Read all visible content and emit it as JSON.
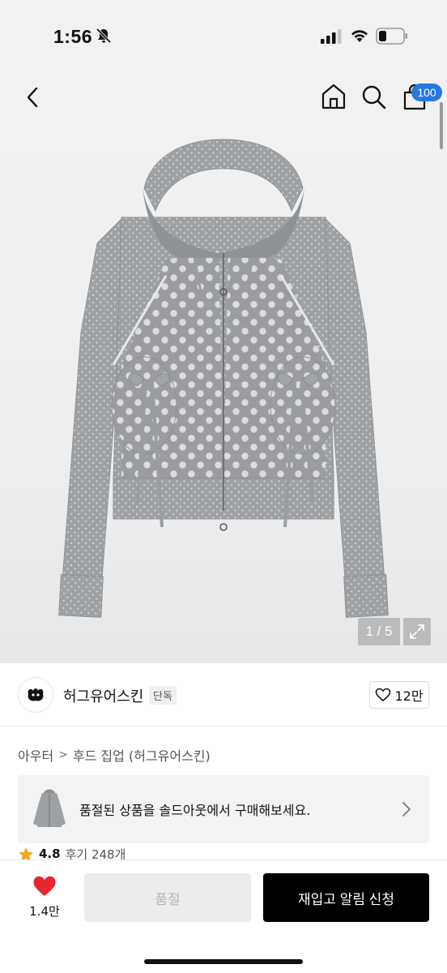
{
  "status_bar": {
    "time": "1:56",
    "icons": [
      "bell-slash-icon",
      "signal-icon",
      "wifi-icon",
      "battery-icon"
    ]
  },
  "nav": {
    "icons": [
      "chevron-left-icon",
      "home-icon",
      "search-icon",
      "shopping-bag-icon"
    ],
    "cart_badge": "100",
    "badge_color": "#2577e3"
  },
  "product_image": {
    "counter": "1 / 5",
    "product_color": "#9ea1a4"
  },
  "brand": {
    "name": "허그유어스킨",
    "tag": "단독",
    "like_count": "12만"
  },
  "breadcrumb": {
    "category": "아우터",
    "subcategory": "후드 집업 (허그유어스킨)"
  },
  "soldout_banner": {
    "text": "품절된 상품을 솔드아웃에서 구매해보세요."
  },
  "rating": {
    "score": "4.8",
    "reviews": "후기 248개"
  },
  "bottom_bar": {
    "wish_count": "1.4만",
    "soldout_label": "품절",
    "restock_label": "재입고 알림 신청",
    "heart_color": "#e8262c"
  }
}
